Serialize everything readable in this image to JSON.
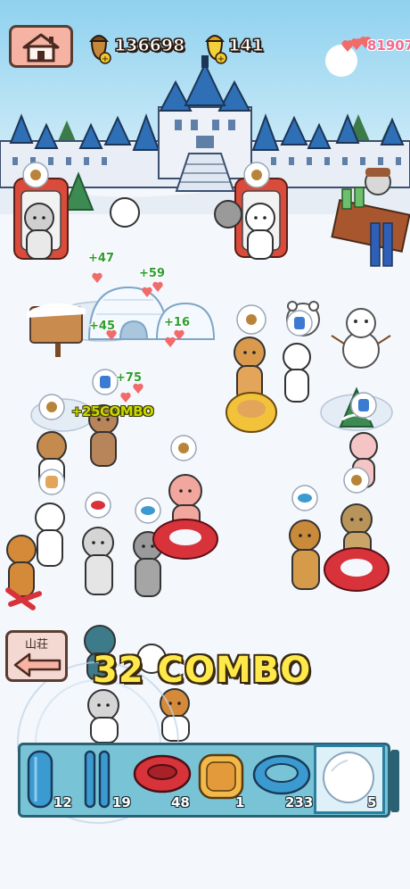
{
  "hud": {
    "acorns": "136698",
    "gold_acorns": "141",
    "hearts": "81907"
  },
  "floating_rewards": [
    "+47",
    "+59",
    "+45",
    "+16",
    "+75"
  ],
  "combo_popup": "+25COMBO",
  "combo_banner": "32 COMBO",
  "back_button": {
    "label": "山荘"
  },
  "item_tray": {
    "slots": [
      {
        "icon": "blue-sled-icon",
        "count": "12"
      },
      {
        "icon": "double-ski-icon",
        "count": "19"
      },
      {
        "icon": "red-tube-icon",
        "count": "48"
      },
      {
        "icon": "orange-sled-icon",
        "count": "1"
      },
      {
        "icon": "blue-tube-icon",
        "count": "233"
      },
      {
        "icon": "snowball-icon",
        "count": "5"
      }
    ]
  },
  "colors": {
    "sky": "#bde4f4",
    "snow": "#f4f7fb",
    "castle": "#2f6fb6",
    "heart": "#f26b8f",
    "combo": "#ffe94a"
  }
}
